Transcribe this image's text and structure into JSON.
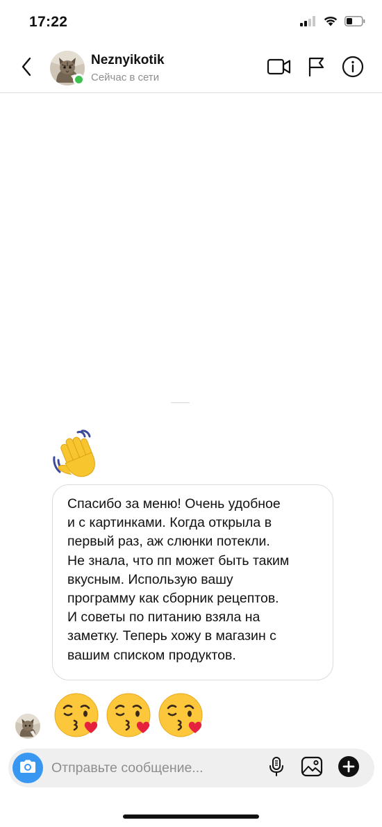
{
  "status_bar": {
    "time": "17:22"
  },
  "header": {
    "username": "Neznyikotik",
    "status": "Сейчас в сети",
    "icons": [
      "chevron-left-icon",
      "video-camera-icon",
      "flag-icon",
      "info-icon"
    ]
  },
  "messages": [
    {
      "type": "emoji",
      "name": "waving-hand-emoji"
    },
    {
      "type": "text",
      "text": "Спасибо за меню! Очень удобное\nи с картинками. Когда открыла в\nпервый раз, аж слюнки потекли.\nНе знала, что пп может быть таким\nвкусным. Использую вашу\nпрограмму как сборник рецептов.\nИ советы по питанию взяла на\nзаметку. Теперь хожу в магазин с\nвашим списком продуктов."
    },
    {
      "type": "emoji",
      "name": "kissing-face-with-heart-emoji",
      "count": 3
    }
  ],
  "composer": {
    "placeholder": "Отправьте сообщение...",
    "value": "",
    "icons": [
      "camera-icon",
      "microphone-icon",
      "gallery-icon",
      "plus-icon"
    ]
  },
  "colors": {
    "online": "#3dc14f",
    "camera_button": "#3897f0",
    "composer_bg": "#efefef",
    "bubble_border": "#dbdbdb",
    "secondary_text": "#8e8e8e"
  }
}
